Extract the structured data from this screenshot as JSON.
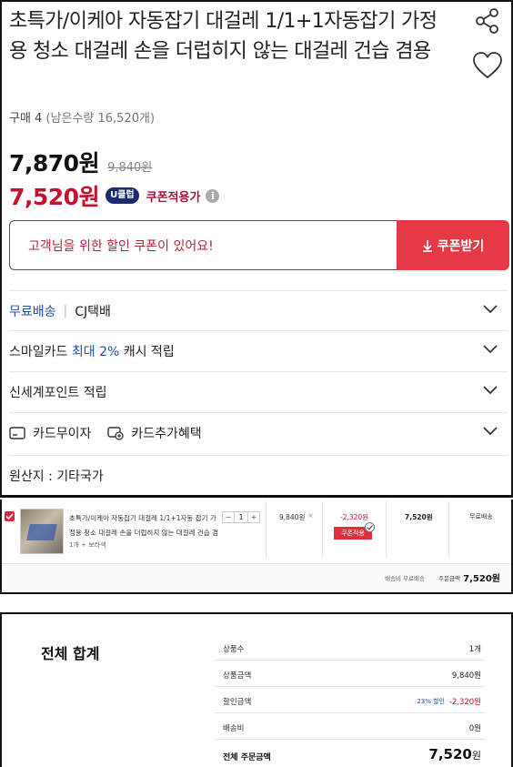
{
  "product": {
    "title": "초특가/이케아 자동잡기 대걸레 1/1+1자동잡기 가정용 청소 대걸레 손을 더럽히지 않는 대걸레 건습 겸용",
    "purchase_count": "구매 4",
    "remaining_stock": "(남은수량 16,520개)",
    "price": "7,870원",
    "original_price": "9,840원",
    "sale_price": "7,520원",
    "u_badge": "U클럽",
    "coupon_price_label": "쿠폰적용가",
    "info_icon": "i"
  },
  "coupon": {
    "message": "고객님을 위한 할인 쿠폰이 있어요!",
    "button": "쿠폰받기"
  },
  "rows": {
    "shipping_free": "무료배송",
    "shipping_courier": "CJ택배",
    "smilecard_prefix": "스마일카드 ",
    "smilecard_highlight": "최대 2%",
    "smilecard_suffix": " 캐시 적립",
    "point": "신세계포인트 적립",
    "card_interest": "카드무이자",
    "card_benefit": "카드추가혜택",
    "origin": "원산지 : 기타국가"
  },
  "cart": {
    "item_name": "초특가/이케아 자동잡기 대걸레 1/1+1자동 잡기 가정용 청소 대걸레 손을 더럽히지 않는 대걸레 건습 겸",
    "option": "1개 + 보라색",
    "qty_minus": "−",
    "qty_value": "1",
    "qty_plus": "+",
    "original_price": "9,840원",
    "remove": "×",
    "discount": "-2,320원",
    "coupon_button": "쿠폰적용",
    "sale_price": "7,520원",
    "shipping": "무료배송",
    "sum_shipping": "배송비 무료배송",
    "sum_label": "주문금액",
    "sum_value": "7,520원"
  },
  "total": {
    "heading": "전체 합계",
    "product_count_label": "상품수",
    "product_count_value": "1개",
    "product_amount_label": "상품금액",
    "product_amount_value": "9,840원",
    "discount_label": "할인금액",
    "discount_rate": "23% 할인",
    "discount_value": "-2,320원",
    "shipping_label": "배송비",
    "shipping_value": "0원",
    "order_total_label": "전체 주문금액",
    "order_total_value": "7,520",
    "order_total_unit": "원"
  },
  "icons": {
    "share": "share-icon",
    "wishlist": "heart-icon",
    "chevron": "chevron-down-icon",
    "card": "card-icon",
    "card_benefit": "card-plus-icon",
    "download": "download-icon"
  },
  "colors": {
    "sale_red": "#c8102e",
    "coupon_button": "#e53946",
    "link_blue": "#1e4fa3",
    "u_badge": "#1d2a6e"
  }
}
